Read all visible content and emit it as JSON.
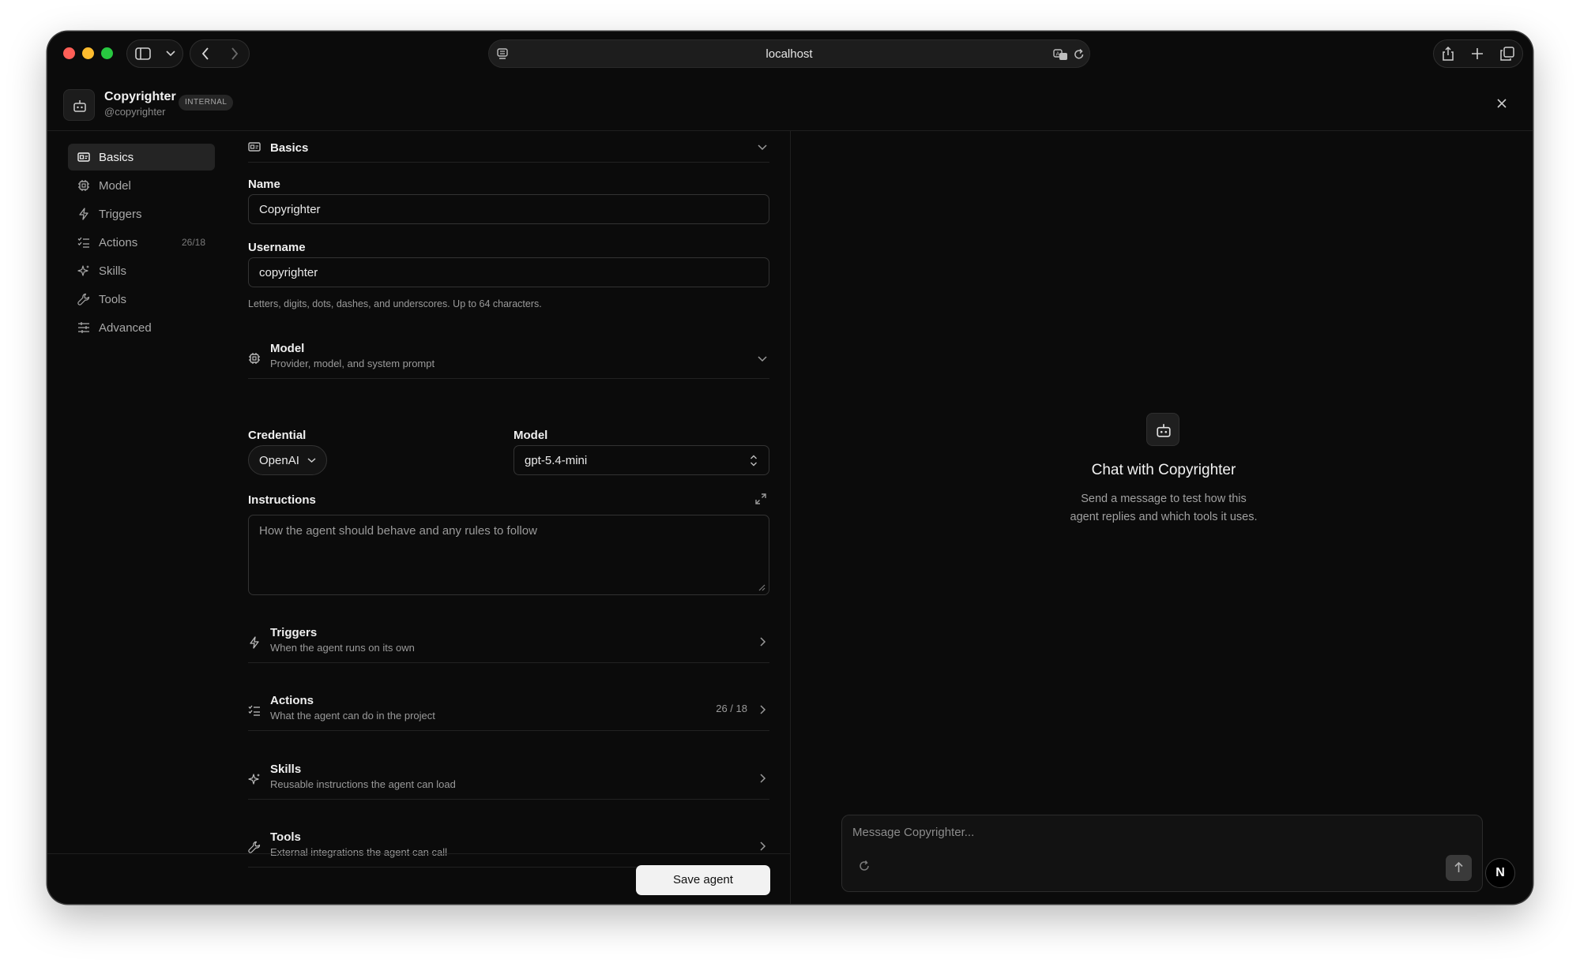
{
  "browser": {
    "url": "localhost"
  },
  "agent": {
    "name": "Copyrighter",
    "handle": "@copyrighter",
    "badge": "INTERNAL"
  },
  "sidebar": {
    "items": [
      {
        "label": "Basics",
        "icon": "id-card-icon",
        "active": true
      },
      {
        "label": "Model",
        "icon": "chip-icon"
      },
      {
        "label": "Triggers",
        "icon": "lightning-icon"
      },
      {
        "label": "Actions",
        "icon": "checklist-icon",
        "count": "26/18"
      },
      {
        "label": "Skills",
        "icon": "sparkles-icon"
      },
      {
        "label": "Tools",
        "icon": "wrench-icon"
      },
      {
        "label": "Advanced",
        "icon": "sliders-icon"
      }
    ]
  },
  "form": {
    "basics": {
      "title": "Basics"
    },
    "name": {
      "label": "Name",
      "value": "Copyrighter"
    },
    "username": {
      "label": "Username",
      "value": "copyrighter",
      "hint": "Letters, digits, dots, dashes, and underscores. Up to 64 characters."
    },
    "model_section": {
      "title": "Model",
      "subtitle": "Provider, model, and system prompt"
    },
    "credential": {
      "label": "Credential",
      "value": "OpenAI"
    },
    "model": {
      "label": "Model",
      "value": "gpt-5.4-mini"
    },
    "instructions": {
      "label": "Instructions",
      "placeholder": "How the agent should behave and any rules to follow"
    },
    "triggers": {
      "title": "Triggers",
      "subtitle": "When the agent runs on its own"
    },
    "actions": {
      "title": "Actions",
      "subtitle": "What the agent can do in the project",
      "count": "26 / 18"
    },
    "skills": {
      "title": "Skills",
      "subtitle": "Reusable instructions the agent can load"
    },
    "tools": {
      "title": "Tools",
      "subtitle": "External integrations the agent can call"
    },
    "save_label": "Save agent"
  },
  "chat": {
    "title": "Chat with Copyrighter",
    "subtitle_line1": "Send a message to test how this",
    "subtitle_line2": "agent replies and which tools it uses.",
    "placeholder": "Message Copyrighter...",
    "avatar_letter": "N"
  },
  "colors": {
    "window_bg": "#0b0b0b",
    "close": "#ff5f57",
    "minimize": "#febc2e",
    "zoom": "#28c840",
    "save_button": "#f2f2f2"
  }
}
